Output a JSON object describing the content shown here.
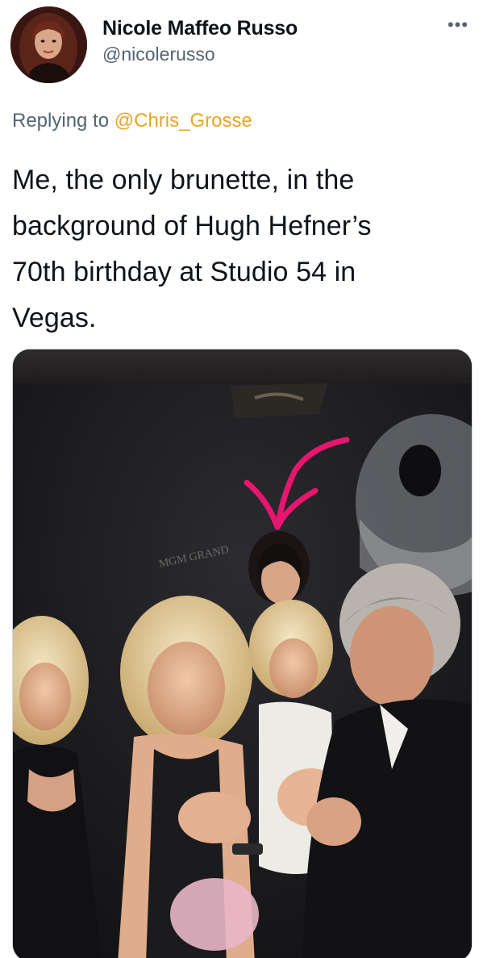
{
  "author": {
    "display_name": "Nicole Maffeo Russo",
    "handle": "@nicolerusso",
    "avatar_icon": "profile-photo"
  },
  "more_icon": "more-options-icon",
  "reply": {
    "prefix": "Replying to",
    "mention": "@Chris_Grosse"
  },
  "tweet": {
    "line1": "Me, the only brunette, in the",
    "line2": "background of Hugh Hefner’s",
    "line3": "70th birthday at Studio 54 in",
    "line4": "Vegas."
  },
  "media": {
    "type": "photo",
    "sign_text": "MGM GRAND",
    "annotation": "pink hand-drawn arrow pointing at brunette"
  },
  "colors": {
    "text": "#0f1419",
    "secondary": "#536471",
    "mention": "#e8a524",
    "arrow": "#e8166f"
  }
}
